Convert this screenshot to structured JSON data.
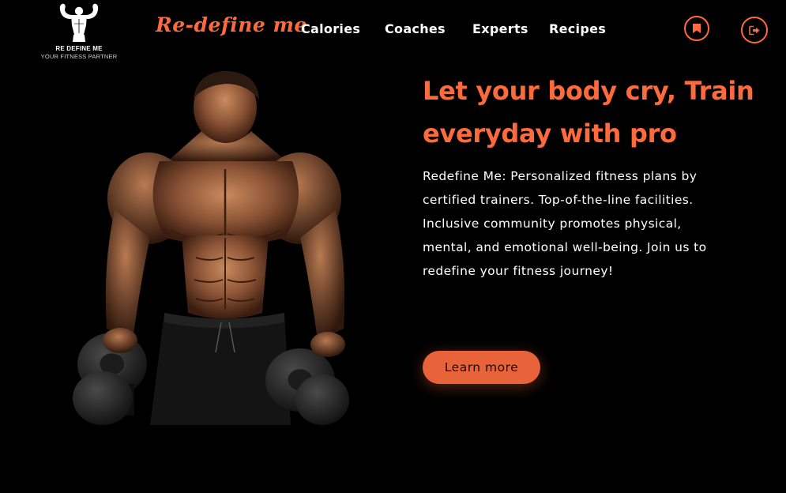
{
  "header": {
    "logo": {
      "title": "RE DEFINE ME",
      "subtitle": "YOUR FITNESS PARTNER"
    },
    "brand": "Re-define me",
    "nav": [
      {
        "label": "Calories"
      },
      {
        "label": "Coaches"
      },
      {
        "label": "Experts"
      },
      {
        "label": "Recipes"
      }
    ],
    "icons": {
      "bookmark": "bookmark-icon",
      "logout": "logout-icon"
    }
  },
  "hero": {
    "headline": "Let your body cry, Train everyday with pro",
    "description": "Redefine Me: Personalized fitness plans by certified trainers. Top-of-the-line facilities. Inclusive community promotes physical, mental, and emotional well-being. Join us to redefine your fitness journey!",
    "cta_label": "Learn more",
    "image": "bodybuilder-with-dumbbells"
  },
  "colors": {
    "accent": "#ff6a3d",
    "button": "#e8623a",
    "background": "#000000",
    "text": "#ffffff"
  }
}
